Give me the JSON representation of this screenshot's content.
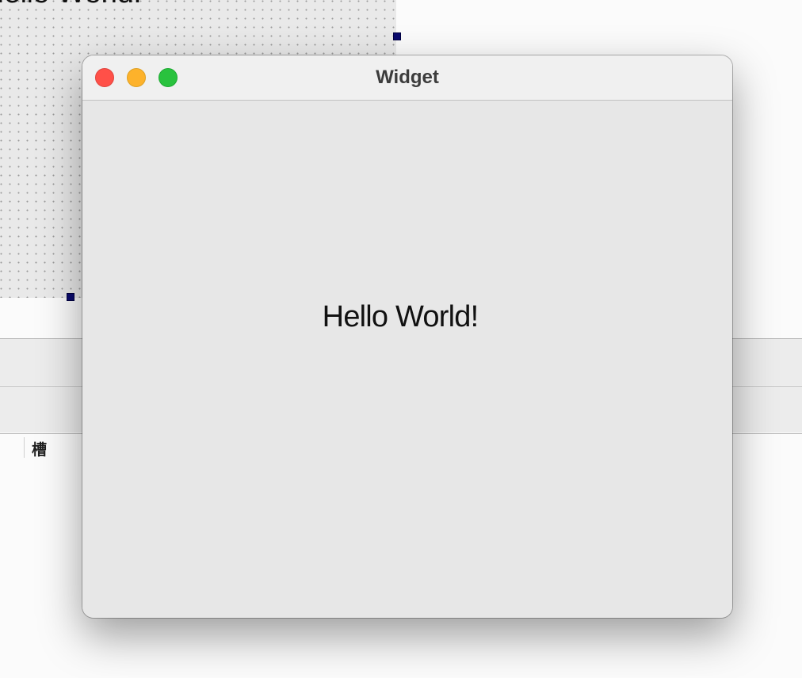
{
  "designer": {
    "canvas_label": "Hello World!",
    "rows": [
      {
        "cell_text": "槽"
      }
    ]
  },
  "window": {
    "title": "Widget",
    "buttons": {
      "close": "close",
      "minimize": "minimize",
      "maximize": "maximize"
    },
    "body": {
      "label": "Hello World!"
    }
  },
  "colors": {
    "close": "#ff5048",
    "minimize": "#fdb22b",
    "maximize": "#29c23e",
    "selection_handle": "#0a0a6e"
  }
}
